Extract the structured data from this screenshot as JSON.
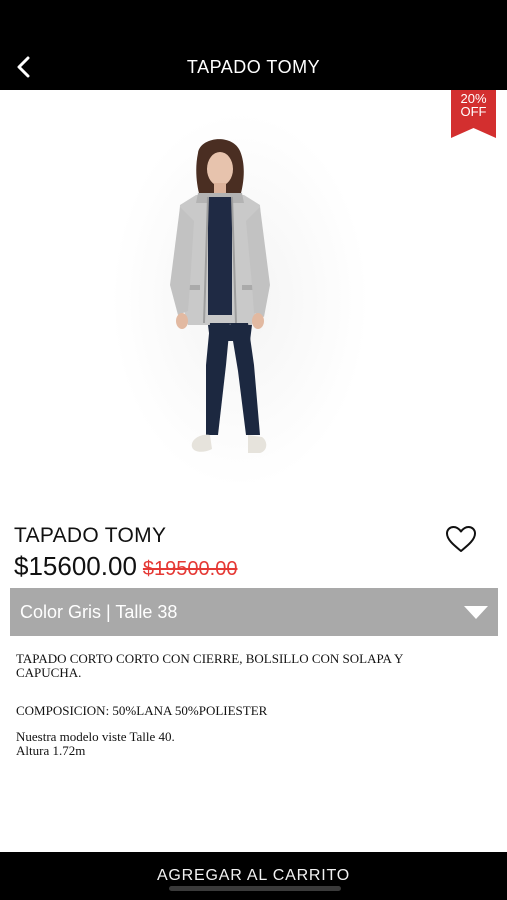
{
  "header": {
    "title": "TAPADO TOMY",
    "back_icon": "chevron-left-icon"
  },
  "gallery": {
    "badge": {
      "line1": "20%",
      "line2": "OFF",
      "color": "#d32f2f"
    },
    "slides_count": 4,
    "active_slide": 1
  },
  "product": {
    "name": "TAPADO TOMY",
    "price": "$15600.00",
    "old_price": "$19500.00",
    "favorite_icon": "heart-outline-icon"
  },
  "variant": {
    "selected": "Color Gris | Talle 38",
    "caret_icon": "caret-down-icon"
  },
  "description": {
    "line1": "TAPADO CORTO CORTO CON CIERRE, BOLSILLO CON SOLAPA Y CAPUCHA.",
    "composition": "COMPOSICION: 50%LANA 50%POLIESTER",
    "model_size": "Nuestra modelo viste Talle 40.",
    "model_height": "Altura 1.72m"
  },
  "cart": {
    "button_label": "AGREGAR AL CARRITO"
  },
  "colors": {
    "header_bg": "#000000",
    "select_bg": "#a9a9a9",
    "old_price": "#e53935",
    "badge": "#d32f2f"
  }
}
